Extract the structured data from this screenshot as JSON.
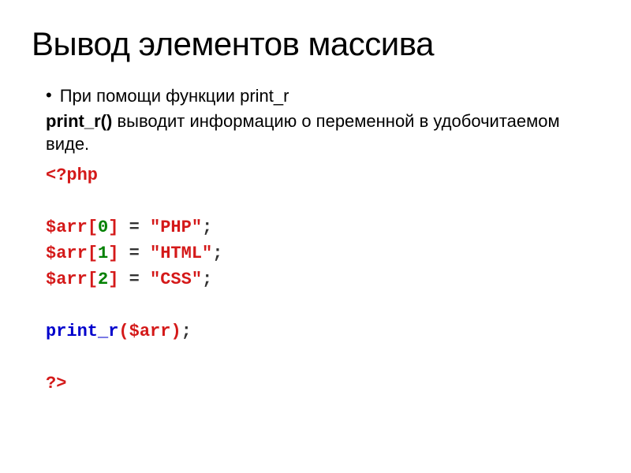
{
  "title": "Вывод элементов массива",
  "bullet_prefix": "При помощи функции ",
  "bullet_func": "print_r",
  "desc_func": "print_r()",
  "desc_rest": " выводит информацию о переменной в удобочитаемом виде.",
  "code": {
    "open_tag": "<?php",
    "lines": [
      {
        "var": "$arr",
        "idx": "0",
        "val": "\"PHP\""
      },
      {
        "var": "$arr",
        "idx": "1",
        "val": "\"HTML\""
      },
      {
        "var": "$arr",
        "idx": "2",
        "val": "\"CSS\""
      }
    ],
    "call_func": "print_r",
    "call_arg": "$arr",
    "close_tag": "?>"
  }
}
